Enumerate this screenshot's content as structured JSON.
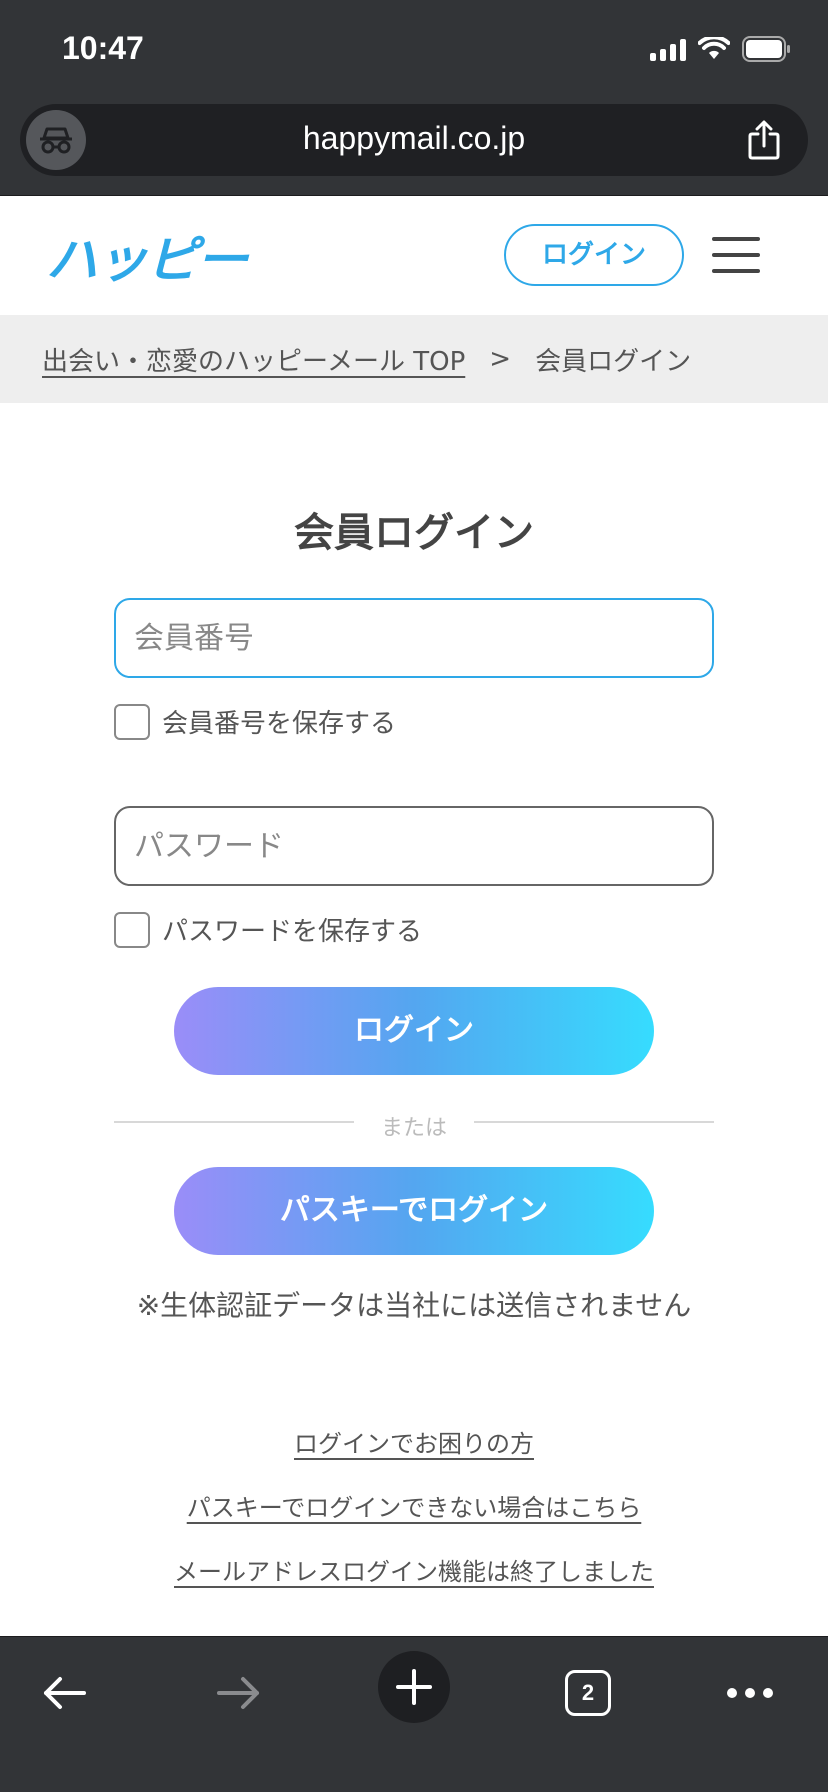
{
  "status_bar": {
    "time": "10:47"
  },
  "browser": {
    "url": "happymail.co.jp",
    "tab_count": "2"
  },
  "header": {
    "logo_text": "ハッピー",
    "login_label": "ログイン"
  },
  "breadcrumb": {
    "home": "出会い・恋愛のハッピーメール TOP",
    "separator": ">",
    "current": "会員ログイン"
  },
  "form": {
    "title": "会員ログイン",
    "member_placeholder": "会員番号",
    "save_member_label": "会員番号を保存する",
    "password_placeholder": "パスワード",
    "save_password_label": "パスワードを保存する",
    "login_button": "ログイン",
    "or_label": "または",
    "passkey_button": "パスキーでログイン",
    "passkey_note": "※生体認証データは当社には送信されません"
  },
  "links": [
    "ログインでお困りの方",
    "パスキーでログインできない場合はこちら",
    "メールアドレスログイン機能は終了しました"
  ],
  "colors": {
    "accent": "#2ea8e8",
    "gradient_start": "#9a8df8",
    "gradient_end": "#36dcfe",
    "chrome": "#323437"
  }
}
